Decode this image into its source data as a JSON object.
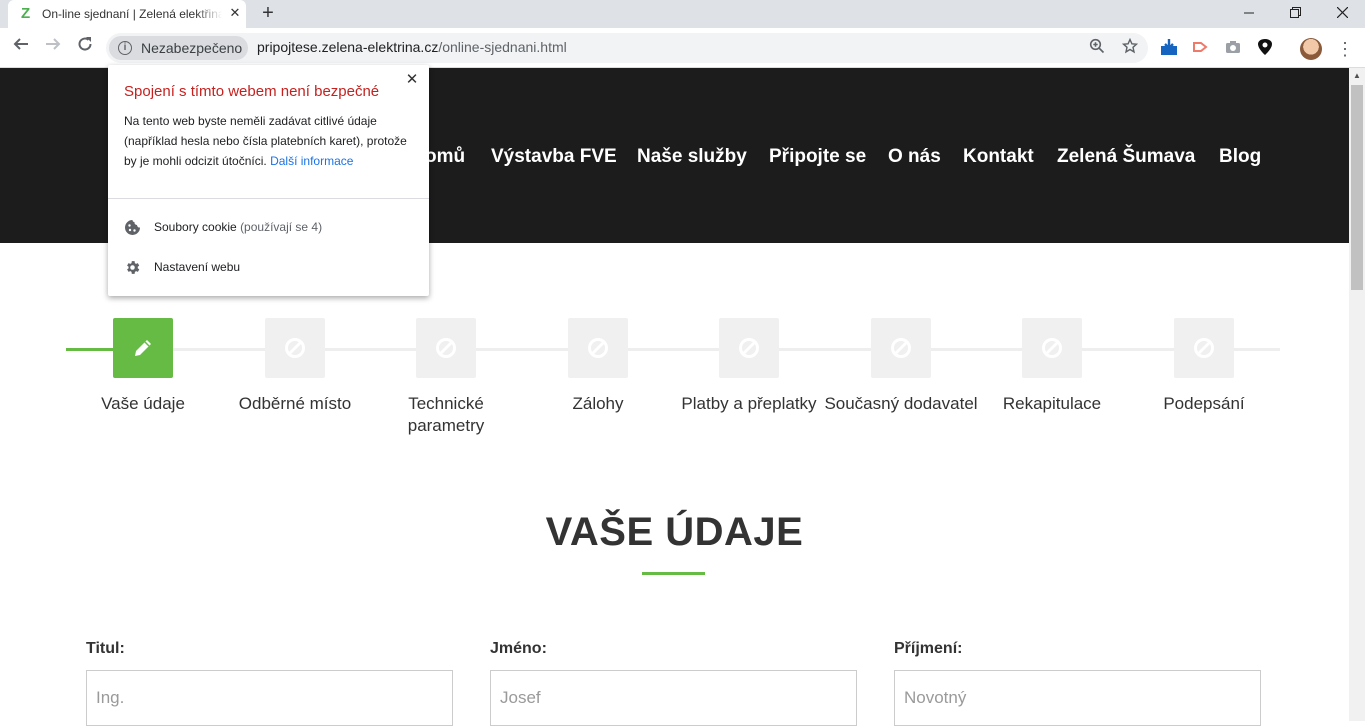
{
  "browser": {
    "tab_title": "On-line sjednaní | Zelená elektřina",
    "favicon_letter": "Z",
    "security_label": "Nezabezpečeno",
    "url_host": "pripojtese.zelena-elektrina.cz",
    "url_path": "/online-sjednani.html"
  },
  "nav": {
    "items": [
      "omů",
      "Výstavba FVE",
      "Naše služby",
      "Připojte se",
      "O nás",
      "Kontakt",
      "Zelená Šumava",
      "Blog"
    ]
  },
  "steps": [
    {
      "label": "Vaše údaje",
      "state": "active"
    },
    {
      "label": "Odběrné místo",
      "state": "disabled"
    },
    {
      "label": "Technické parametry",
      "state": "disabled"
    },
    {
      "label": "Zálohy",
      "state": "disabled"
    },
    {
      "label": "Platby a přeplatky",
      "state": "disabled"
    },
    {
      "label": "Současný dodavatel",
      "state": "disabled"
    },
    {
      "label": "Rekapitulace",
      "state": "disabled"
    },
    {
      "label": "Podepsání",
      "state": "disabled"
    }
  ],
  "section": {
    "title": "VAŠE ÚDAJE"
  },
  "form": {
    "title_label": "Titul:",
    "title_placeholder": "Ing.",
    "first_name_label": "Jméno:",
    "first_name_placeholder": "Josef",
    "last_name_label": "Příjmení:",
    "last_name_placeholder": "Novotný"
  },
  "popup": {
    "title": "Spojení s tímto webem není bezpečné",
    "body": "Na tento web byste neměli zadávat citlivé údaje (například hesla nebo čísla platebních karet), protože by je mohli odcizit útočníci.",
    "link": "Další informace",
    "cookies_label": "Soubory cookie",
    "cookies_count": "(používají se 4)",
    "settings_label": "Nastavení webu"
  },
  "colors": {
    "accent_green": "#66bb44",
    "header_bg": "#1c1c1c",
    "warning_red": "#c5221f",
    "link_blue": "#1a73e8"
  }
}
